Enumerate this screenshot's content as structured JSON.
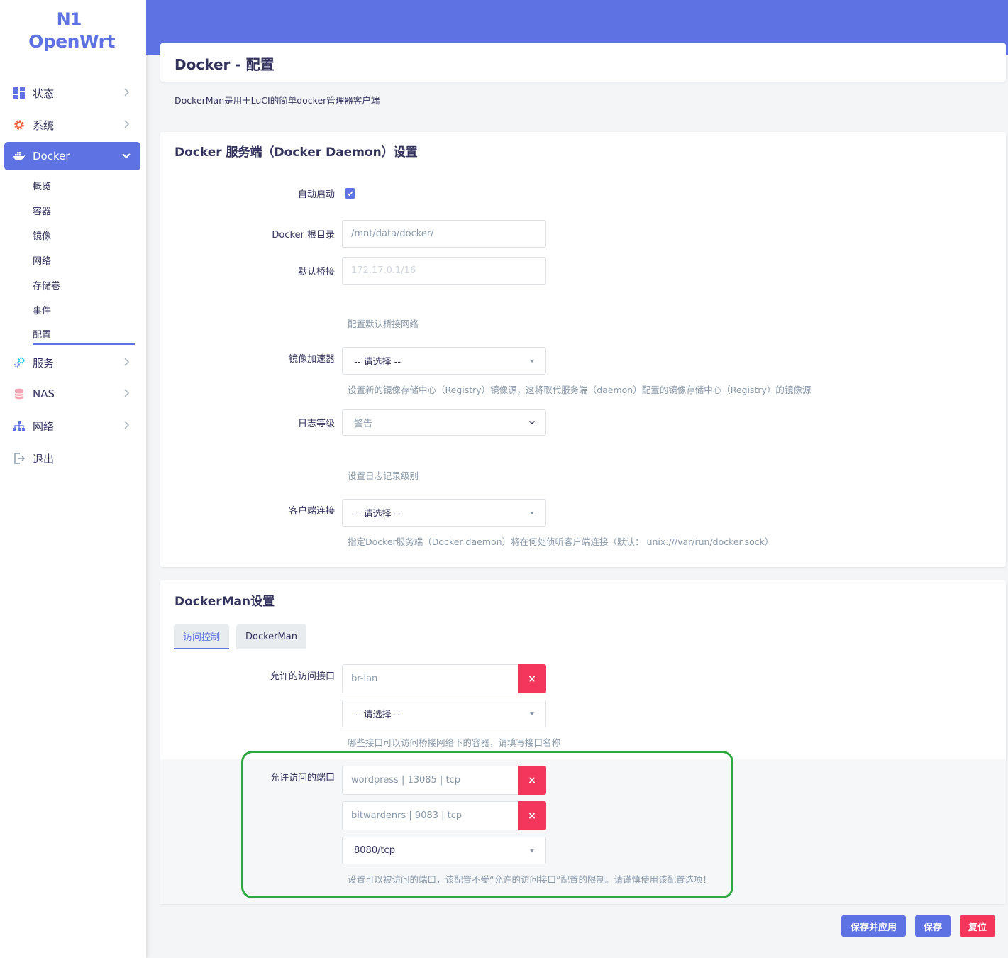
{
  "brand": {
    "line1": "N1",
    "line2": "OpenWrt"
  },
  "sidebar": {
    "items": [
      {
        "label": "状态",
        "icon": "dashboard-icon"
      },
      {
        "label": "系统",
        "icon": "gear-icon"
      },
      {
        "label": "Docker",
        "icon": "docker-icon"
      },
      {
        "label": "服务",
        "icon": "services-icon"
      },
      {
        "label": "NAS",
        "icon": "database-icon"
      },
      {
        "label": "网络",
        "icon": "network-icon"
      },
      {
        "label": "退出",
        "icon": "logout-icon"
      }
    ],
    "docker_sub": [
      "概览",
      "容器",
      "镜像",
      "网络",
      "存储卷",
      "事件",
      "配置"
    ]
  },
  "page": {
    "title": "Docker - 配置",
    "description": "DockerMan是用于LuCI的简单docker管理器客户端"
  },
  "daemon": {
    "title": "Docker 服务端（Docker Daemon）设置",
    "autostart_label": "自动启动",
    "root_label": "Docker 根目录",
    "root_value": "/mnt/data/docker/",
    "bridge_label": "默认桥接",
    "bridge_placeholder": "172.17.0.1/16",
    "bridge_help": "配置默认桥接网络",
    "mirror_label": "镜像加速器",
    "mirror_value": "-- 请选择 --",
    "mirror_help": "设置新的镜像存储中心（Registry）镜像源，这将取代服务端（daemon）配置的镜像存储中心（Registry）的镜像源",
    "loglevel_label": "日志等级",
    "loglevel_value": "警告",
    "loglevel_help": "设置日志记录级别",
    "client_label": "客户端连接",
    "client_value": "-- 请选择 --",
    "client_help": "指定Docker服务端（Docker daemon）将在何处侦听客户端连接（默认： unix:///var/run/docker.sock）"
  },
  "dockerman": {
    "title": "DockerMan设置",
    "tabs": [
      "访问控制",
      "DockerMan"
    ],
    "iface_label": "允许的访问接口",
    "iface_value": "br-lan",
    "iface_select": "-- 请选择 --",
    "iface_help": "哪些接口可以访问桥接网络下的容器，请填写接口名称",
    "ports_label": "允许访问的端口",
    "port1": "wordpress | 13085 | tcp",
    "port2": "bitwardenrs | 9083 | tcp",
    "port_select": "8080/tcp",
    "ports_help": "设置可以被访问的端口，该配置不受“允许的访问接口”配置的限制。请谨慎使用该配置选项！",
    "remove_symbol": "×"
  },
  "actions": {
    "save_apply": "保存并应用",
    "save": "保存",
    "reset": "复位"
  },
  "colors": {
    "accent": "#5e72e4",
    "danger": "#f5365c",
    "highlight": "#2ea840"
  }
}
